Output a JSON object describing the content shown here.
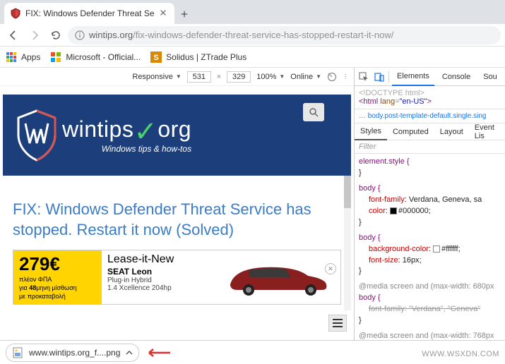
{
  "tab": {
    "title": "FIX: Windows Defender Threat Se"
  },
  "address": {
    "host": "wintips.org",
    "path": "/fix-windows-defender-threat-service-has-stopped-restart-it-now/"
  },
  "bookmarks": {
    "apps": "Apps",
    "ms": "Microsoft - Official...",
    "solidus": "Solidus | ZTrade Plus"
  },
  "device_bar": {
    "mode": "Responsive",
    "width": "531",
    "height": "329",
    "zoom": "100%",
    "throttle": "Online"
  },
  "page": {
    "brand_left": "wintips",
    "brand_right": "org",
    "tagline": "Windows tips & how-tos",
    "article_title": "FIX: Windows Defender Threat Service has stopped. Restart it now (Solved)"
  },
  "ad": {
    "price": "279€",
    "line1": "πλέον ΦΠΑ",
    "line2_a": "για ",
    "line2_b": "48",
    "line2_c": "μηνη μίσθωση",
    "line3": "με προκαταβολή",
    "title": "Lease-it-New",
    "model": "SEAT Leon",
    "spec1": "Plug-in Hybrid",
    "spec2": "1.4 Xcellence 204hp"
  },
  "devtools": {
    "tabs": {
      "elements": "Elements",
      "console": "Console",
      "sources": "Sou"
    },
    "dom": {
      "doctype": "<!DOCTYPE html>",
      "html_open": "<html lang=\"en-US\">"
    },
    "crumb_prefix": "…  ",
    "crumb_sel": "body.post-template-default.single.sing",
    "subtabs": {
      "styles": "Styles",
      "computed": "Computed",
      "layout": "Layout",
      "eventlis": "Event Lis"
    },
    "filter_placeholder": "Filter",
    "css": {
      "elstyle": "element.style {",
      "body1_sel": "body {",
      "body1_p1": "font-family",
      "body1_v1": "Verdana, Geneva, sa",
      "body1_p2": "color",
      "body1_v2": "#000000",
      "body2_sel": "body {",
      "body2_p1": "background-color",
      "body2_v1": "#ffffff",
      "body2_p2": "font-size",
      "body2_v2": "16px",
      "media1": "@media screen and (max-width: 680px",
      "media1_sel": "body {",
      "media1_p1": "font-family",
      "media1_v1": "\"Verdana\", \"Geneva\"",
      "media2": "@media screen and (max-width: 768px",
      "close": "}"
    }
  },
  "download": {
    "filename": "www.wintips.org_f....png"
  },
  "watermark": "WWW.WSXDN.COM"
}
